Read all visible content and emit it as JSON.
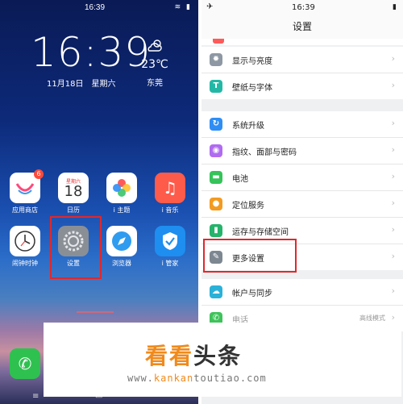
{
  "home": {
    "status_time": "16:39",
    "status_icons": "≋ ▮",
    "clock": "16:39",
    "date": "11月18日",
    "weekday": "星期六",
    "weather_icon": "cloud-sun-icon",
    "temperature": "23℃",
    "city": "东莞",
    "apps": [
      {
        "label": "应用商店",
        "badge": "6",
        "icon": "app-store-icon",
        "color": "#ffffff"
      },
      {
        "label": "日历",
        "icon_text": "18",
        "icon_sub": "星期六",
        "icon": "calendar-icon",
        "color": "#ffffff"
      },
      {
        "label": "i 主题",
        "icon": "themes-icon",
        "color": "#ffffff"
      },
      {
        "label": "i 音乐",
        "icon": "music-icon",
        "color": "#ff5b4a"
      },
      {
        "label": "闹钟时钟",
        "icon": "clock-icon",
        "color": "#ffffff"
      },
      {
        "label": "设置",
        "icon": "settings-gear-icon",
        "color": "#8a8f96"
      },
      {
        "label": "浏览器",
        "icon": "browser-compass-icon",
        "color": "#ffffff"
      },
      {
        "label": "i 管家",
        "icon": "shield-check-icon",
        "color": "#1e8ef0"
      }
    ],
    "dock": {
      "icon": "phone-icon",
      "color": "#2ec14f"
    }
  },
  "settings": {
    "status_time": "16:39",
    "status_icon": "airplane-icon",
    "title": "设置",
    "groups": [
      [
        {
          "label": "显示与亮度",
          "icon": "brightness-icon",
          "color": "#8e98a4",
          "glyph": "✹"
        },
        {
          "label": "壁纸与字体",
          "icon": "wallpaper-font-icon",
          "color": "#23b8a6",
          "glyph": "T"
        }
      ],
      [
        {
          "label": "系统升级",
          "icon": "system-update-icon",
          "color": "#2f8ef5",
          "glyph": "↻"
        },
        {
          "label": "指纹、面部与密码",
          "icon": "fingerprint-icon",
          "color": "#b06cf0",
          "glyph": "◉"
        },
        {
          "label": "电池",
          "icon": "battery-icon",
          "color": "#35c35a",
          "glyph": "▬"
        },
        {
          "label": "定位服务",
          "icon": "location-icon",
          "color": "#f39a21",
          "glyph": "⬤"
        },
        {
          "label": "运存与存储空间",
          "icon": "storage-icon",
          "color": "#26b36b",
          "glyph": "▮"
        },
        {
          "label": "更多设置",
          "icon": "wrench-icon",
          "color": "#7d8791",
          "glyph": "✎"
        }
      ],
      [
        {
          "label": "帐户与同步",
          "icon": "account-sync-icon",
          "color": "#2ab1d8",
          "glyph": "☁"
        },
        {
          "label": "电话",
          "icon": "phone-icon",
          "color": "#3ec35a",
          "glyph": "✆",
          "value": "高线模式"
        }
      ]
    ]
  },
  "watermark": {
    "title_part1": "看看",
    "title_part2": "头条",
    "url_part1": "www.",
    "url_part2": "kankan",
    "url_part3": "toutiao.com"
  },
  "colors": {
    "highlight": "#e0282c",
    "watermark_orange": "#f08a1c"
  }
}
